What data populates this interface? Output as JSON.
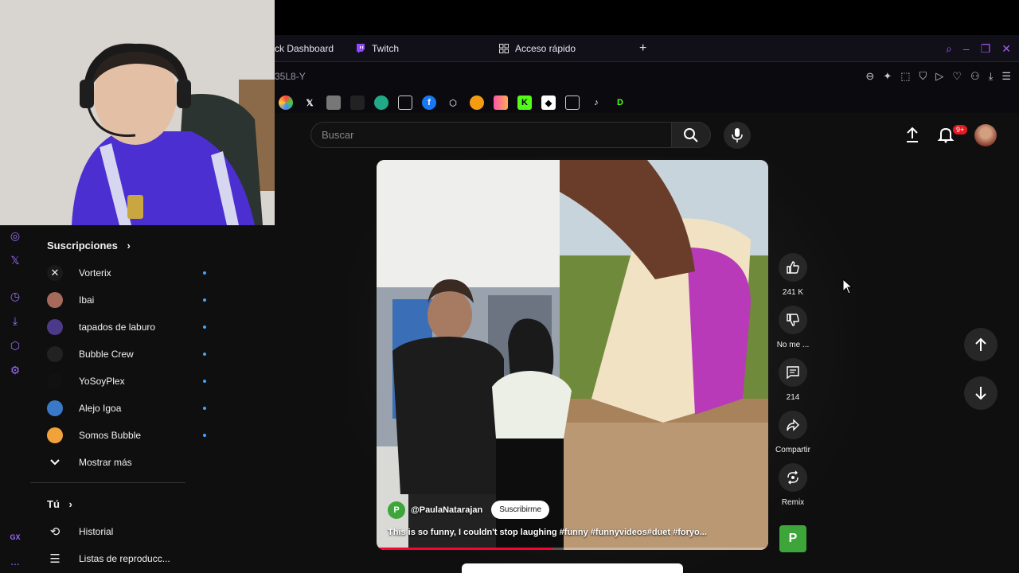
{
  "browser": {
    "tabs": [
      {
        "label": "ck Dashboard"
      },
      {
        "label": "Twitch"
      },
      {
        "label": "Acceso rápido"
      }
    ],
    "new_tab": "+",
    "address": "35L8-Y",
    "accent": "#a25cf5"
  },
  "header": {
    "search_placeholder": "Buscar",
    "notifications_badge": "9+"
  },
  "sidebar": {
    "subscriptions_title": "Suscripciones",
    "subscriptions": [
      {
        "label": "Vorterix",
        "color": "#1a1a1a"
      },
      {
        "label": "Ibai",
        "color": "#a66a5a"
      },
      {
        "label": "tapados de laburo",
        "color": "#4b3a8a"
      },
      {
        "label": "Bubble Crew",
        "color": "#222"
      },
      {
        "label": "YoSoyPlex",
        "color": "#111"
      },
      {
        "label": "Alejo Igoa",
        "color": "#3a78c8"
      },
      {
        "label": "Somos Bubble",
        "color": "#f2a23a"
      }
    ],
    "show_more": "Mostrar más",
    "you_title": "Tú",
    "you_items": [
      {
        "label": "Historial"
      },
      {
        "label": "Listas de reproducc..."
      }
    ]
  },
  "short": {
    "channel_initial": "P",
    "channel_name": "@PaulaNatarajan",
    "subscribe_label": "Suscribirme",
    "title": "This is so funny, I couldn't stop laughing #funny #funnyvideos#duet #foryo...",
    "progress": 0.45,
    "actions": {
      "likes": "241 K",
      "dislike": "No me ...",
      "comments": "214",
      "share": "Compartir",
      "remix": "Remix"
    },
    "channel_badge": "P"
  },
  "rail": {
    "bottom_label": "GX",
    "more": "..."
  }
}
